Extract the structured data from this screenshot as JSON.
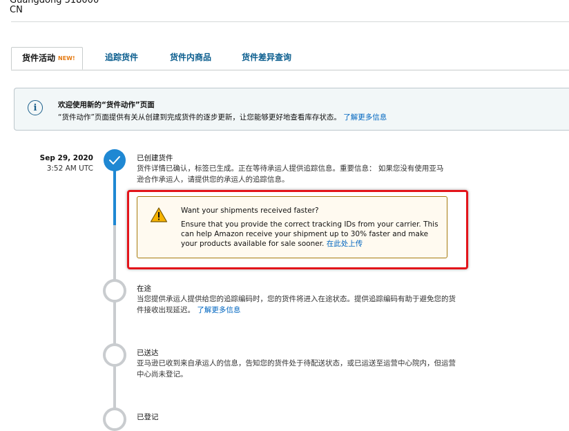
{
  "address": {
    "line1": "Guangdong 518000",
    "line2": "CN"
  },
  "tabs": [
    {
      "label": "货件活动",
      "badge": "NEW!"
    },
    {
      "label": "追踪货件"
    },
    {
      "label": "货件内商品"
    },
    {
      "label": "货件差异查询"
    }
  ],
  "info": {
    "title": "欢迎使用新的“货件动作”页面",
    "body": "“货件动作”页面提供有关从创建到完成货件的逐步更新，让您能够更好地查看库存状态。",
    "link": "了解更多信息"
  },
  "timeline": {
    "date": "Sep 29, 2020",
    "time": "3:52 AM UTC",
    "steps": [
      {
        "title": "已创建货件",
        "text": "货件详情已确认，标签已生成。正在等待承运人提供追踪信息。重要信息： 如果您没有使用亚马逊合作承运人，请提供您的承运人的追踪信息。"
      },
      {
        "title": "在途",
        "text": "当您提供承运人提供给您的追踪编码时，您的货件将进入在途状态。提供追踪编码有助于避免您的货件接收出现延迟。",
        "link": "了解更多信息"
      },
      {
        "title": "已送达",
        "text": "亚马逊已收到来自承运人的信息，告知您的货件处于待配送状态，或已运送至运营中心院内，但运营中心尚未登记。"
      },
      {
        "title": "已登记"
      }
    ]
  },
  "warning": {
    "title": "Want your shipments received faster?",
    "body": "Ensure that you provide the correct tracking IDs from your carrier. This can help Amazon receive your shipment up to 30% faster and make your products available for sale sooner.",
    "link": "在此处上传"
  },
  "colors": {
    "accent": "#1f88d3",
    "link": "#0066c0",
    "highlight": "#e3141a",
    "badge": "#e47911"
  }
}
